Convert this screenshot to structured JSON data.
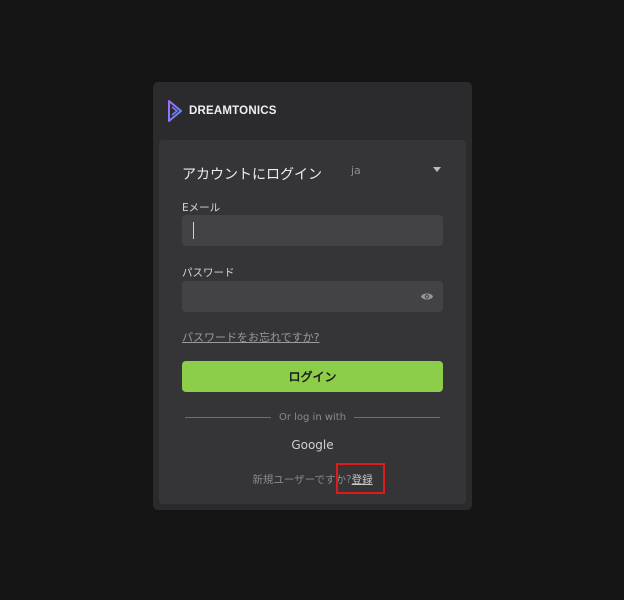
{
  "brand": {
    "name": "DREAMTONICS",
    "logo_icon": "dreamtonics-logo-icon"
  },
  "form": {
    "title": "アカウントにログイン",
    "language": {
      "selected": "ja"
    },
    "email": {
      "label": "Eメール",
      "value": ""
    },
    "password": {
      "label": "パスワード",
      "value": "",
      "toggle_icon": "eye-icon"
    },
    "forgot_password": "パスワードをお忘れですか?",
    "login_button": "ログイン",
    "alt_login_label": "Or log in with",
    "google": "Google",
    "signup_prompt": "新規ユーザーですか?",
    "signup_link": "登録"
  },
  "colors": {
    "accent": "#8ccd4a",
    "background": "#141414",
    "card": "#2b2b2d",
    "panel": "#353537",
    "field": "#434345",
    "highlight": "#e01a1a"
  }
}
